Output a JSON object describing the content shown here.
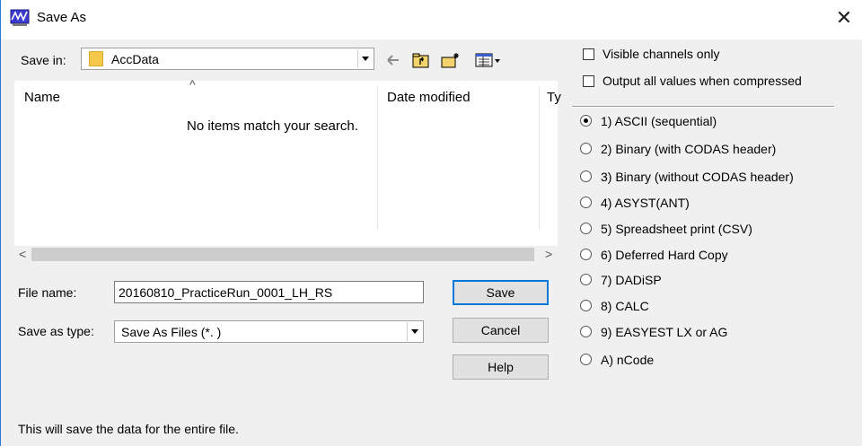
{
  "window": {
    "title": "Save As",
    "close_glyph": "✕"
  },
  "save_in": {
    "label": "Save in:",
    "value": "AccData"
  },
  "toolbar": {
    "icons": [
      "back-arrow-icon",
      "up-folder-icon",
      "new-folder-icon",
      "view-menu-icon"
    ]
  },
  "file_list": {
    "columns": [
      "Name",
      "Date modified",
      "Ty"
    ],
    "sort_glyph": "^",
    "empty_message": "No items match your search.",
    "scroll_left": "<",
    "scroll_right": ">"
  },
  "file_name": {
    "label": "File name:",
    "value": "20160810_PracticeRun_0001_LH_RS"
  },
  "save_as_type": {
    "label": "Save as type:",
    "value": "Save As Files (*.   )"
  },
  "buttons": {
    "save": "Save",
    "cancel": "Cancel",
    "help": "Help"
  },
  "checkboxes": [
    {
      "label": "Visible channels only",
      "checked": false
    },
    {
      "label": "Output all values when compressed",
      "checked": false
    }
  ],
  "formats": [
    {
      "label": "1) ASCII (sequential)",
      "selected": true
    },
    {
      "label": "2) Binary (with CODAS header)",
      "selected": false
    },
    {
      "label": "3) Binary (without CODAS header)",
      "selected": false
    },
    {
      "label": "4) ASYST(ANT)",
      "selected": false
    },
    {
      "label": "5) Spreadsheet print (CSV)",
      "selected": false
    },
    {
      "label": "6) Deferred Hard Copy",
      "selected": false
    },
    {
      "label": "7) DADiSP",
      "selected": false
    },
    {
      "label": "8) CALC",
      "selected": false
    },
    {
      "label": "9) EASYEST LX or AG",
      "selected": false
    },
    {
      "label": "A) nCode",
      "selected": false
    }
  ],
  "status_text": "This will save the data for the entire file.",
  "colors": {
    "accent": "#0078d7",
    "window_border": "#2b79d5",
    "folder": "#f5c84c"
  }
}
